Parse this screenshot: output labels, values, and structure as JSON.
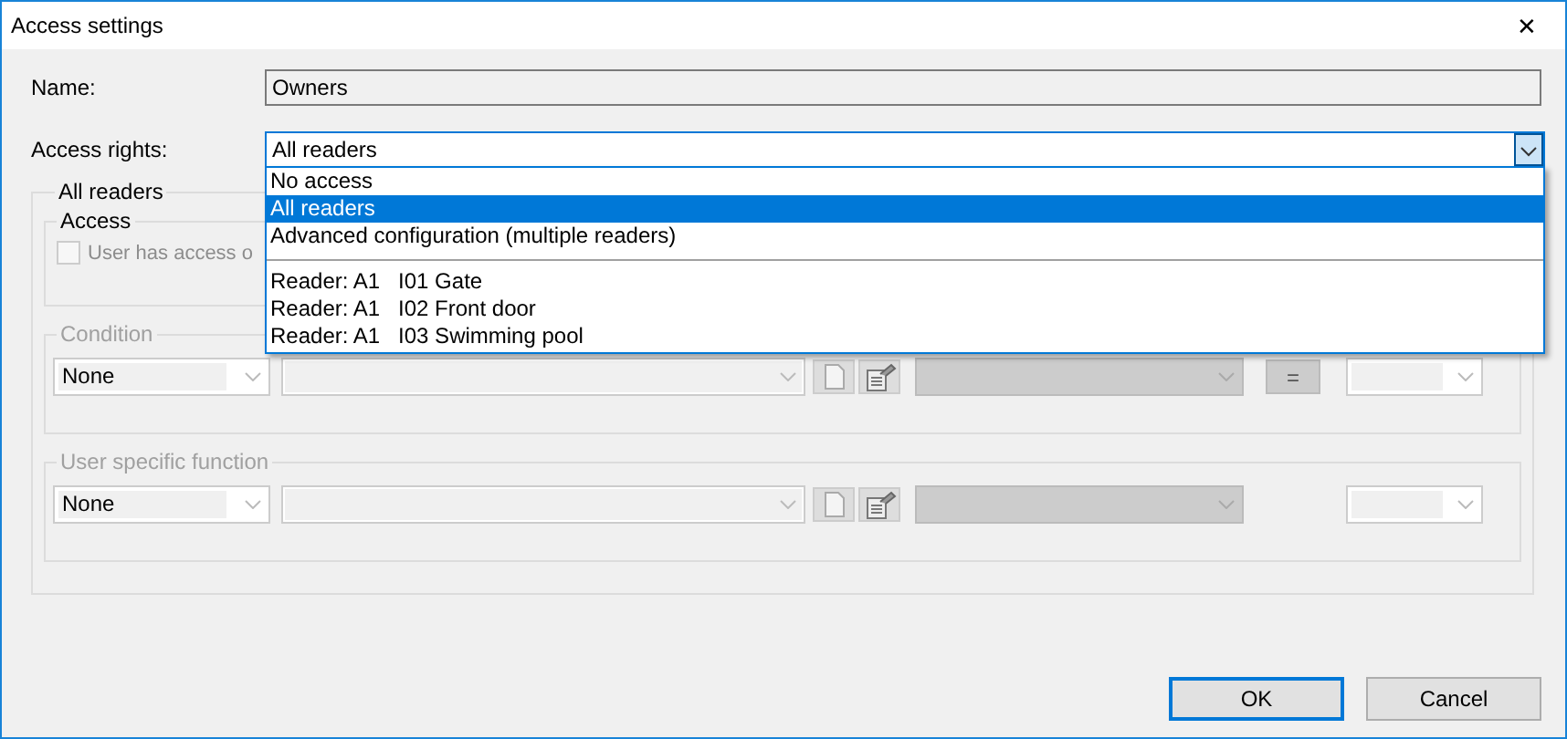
{
  "window": {
    "title": "Access settings",
    "close": "✕"
  },
  "name": {
    "label": "Name:",
    "value": "Owners"
  },
  "access_rights": {
    "label": "Access rights:",
    "value": "All readers",
    "expanded": true,
    "option_groups": [
      [
        {
          "label": "No access",
          "selected": false
        },
        {
          "label": "All readers",
          "selected": true
        },
        {
          "label": "Advanced configuration (multiple readers)",
          "selected": false
        }
      ],
      [
        {
          "label": "Reader: A1   I01 Gate",
          "selected": false
        },
        {
          "label": "Reader: A1   I02 Front door",
          "selected": false
        },
        {
          "label": "Reader: A1   I03 Swimming pool",
          "selected": false
        }
      ]
    ]
  },
  "group": {
    "title": "All readers",
    "access": {
      "title": "Access",
      "checkbox": {
        "label": "User has access o",
        "checked": false,
        "disabled": true
      }
    },
    "rows": [
      {
        "title": "Condition",
        "select": "None",
        "operator": "="
      },
      {
        "title": "User specific function",
        "select": "None"
      }
    ]
  },
  "buttons": [
    {
      "label": "OK",
      "default": true
    },
    {
      "label": "Cancel",
      "default": false
    }
  ]
}
